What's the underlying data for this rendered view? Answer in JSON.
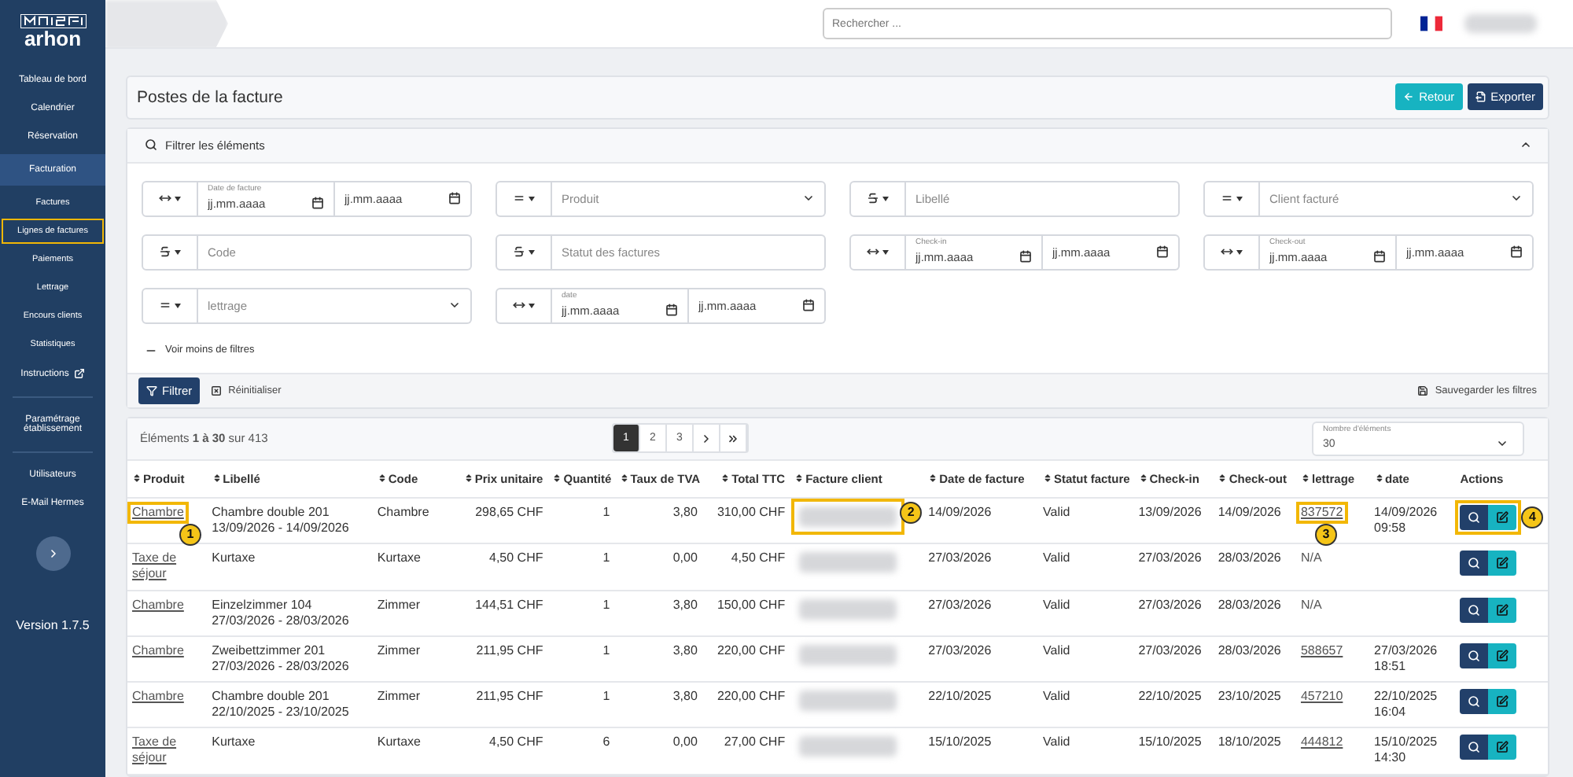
{
  "sidebar": {
    "logo_text": "arhon",
    "items": [
      {
        "label": "Tableau de bord",
        "selected": false,
        "external": false,
        "divider_after": false
      },
      {
        "label": "Calendrier",
        "selected": false,
        "external": false,
        "divider_after": false
      },
      {
        "label": "Réservation",
        "selected": false,
        "external": false,
        "divider_after": false
      },
      {
        "label": "Facturation",
        "selected": true,
        "external": false,
        "divider_after": false,
        "children": [
          {
            "label": "Factures",
            "highlight": false
          },
          {
            "label": "Lignes de factures",
            "highlight": true
          },
          {
            "label": "Paiements",
            "highlight": false
          },
          {
            "label": "Lettrage",
            "highlight": false
          },
          {
            "label": "Encours clients",
            "highlight": false
          },
          {
            "label": "Statistiques",
            "highlight": false
          }
        ]
      },
      {
        "label": "Instructions",
        "selected": false,
        "external": true,
        "divider_after": true
      },
      {
        "label": "Paramétrage établissement",
        "selected": false,
        "external": false,
        "divider_after": true
      },
      {
        "label": "Utilisateurs",
        "selected": false,
        "external": false,
        "divider_after": false
      },
      {
        "label": "E-Mail Hermes",
        "selected": false,
        "external": false,
        "divider_after": false
      }
    ],
    "version": "Version 1.7.5"
  },
  "topbar": {
    "search": {
      "placeholder": "Rechercher ..."
    }
  },
  "page": {
    "title": "Postes de la facture",
    "buttons": [
      {
        "label": "Retour",
        "kind": "back"
      },
      {
        "label": "Exporter",
        "kind": "export"
      }
    ]
  },
  "filters": {
    "title": "Filtrer les éléments",
    "expanded": true,
    "items": [
      {
        "kind": "date_range",
        "label": "Date de facture",
        "from_placeholder": "jj.mm.aaaa",
        "to_placeholder": "jj.mm.aaaa"
      },
      {
        "kind": "select",
        "placeholder": "Produit"
      },
      {
        "kind": "text",
        "placeholder": "Libellé"
      },
      {
        "kind": "select",
        "placeholder": "Client facturé"
      },
      {
        "kind": "text",
        "placeholder": "Code"
      },
      {
        "kind": "text",
        "placeholder": "Statut des factures"
      },
      {
        "kind": "date_range",
        "label": "Check-in",
        "from_placeholder": "jj.mm.aaaa",
        "to_placeholder": "jj.mm.aaaa"
      },
      {
        "kind": "date_range",
        "label": "Check-out",
        "from_placeholder": "jj.mm.aaaa",
        "to_placeholder": "jj.mm.aaaa"
      },
      {
        "kind": "select",
        "placeholder": "lettrage"
      },
      {
        "kind": "date_range",
        "label": "date",
        "from_placeholder": "jj.mm.aaaa",
        "to_placeholder": "jj.mm.aaaa"
      }
    ],
    "toggle_label": "Voir moins de filtres",
    "filter_button": "Filtrer",
    "reset_button": "Réinitialiser",
    "save_button": "Sauvegarder les filtres"
  },
  "table": {
    "summary": "Éléments **1 à 30** sur 413",
    "pages": [
      {
        "label": "1",
        "selected": true
      },
      {
        "label": "2",
        "selected": false
      },
      {
        "label": "3",
        "selected": false
      }
    ],
    "page_size": {
      "label": "Nombre d'éléments",
      "value": "30"
    },
    "columns": [
      {
        "label": "Produit",
        "sortable": true
      },
      {
        "label": "Libellé",
        "sortable": true
      },
      {
        "label": "Code",
        "sortable": true
      },
      {
        "label": "Prix unitaire",
        "sortable": true
      },
      {
        "label": "Quantité",
        "sortable": true
      },
      {
        "label": "Taux de TVA",
        "sortable": true
      },
      {
        "label": "Total TTC",
        "sortable": true
      },
      {
        "label": "Facture client",
        "sortable": true
      },
      {
        "label": "Date de facture",
        "sortable": true
      },
      {
        "label": "Statut facture",
        "sortable": true
      },
      {
        "label": "Check-in",
        "sortable": true
      },
      {
        "label": "Check-out",
        "sortable": true
      },
      {
        "label": "lettrage",
        "sortable": true
      },
      {
        "label": "date",
        "sortable": true
      },
      {
        "label": "Actions",
        "sortable": false
      }
    ],
    "rows": [
      {
        "produit": {
          "text": "Chambre",
          "highlight": true,
          "callout": "1"
        },
        "libelle": [
          "Chambre double 201",
          "13/09/2026 - 14/09/2026"
        ],
        "code": "Chambre",
        "prix": "298,65 CHF",
        "quantite": "1",
        "taux": "3,80",
        "total": "310,00 CHF",
        "facture_client": {
          "highlight": true,
          "callout": "2"
        },
        "date_facture": "14/09/2026",
        "statut": "Valid",
        "check_in": "13/09/2026",
        "check_out": "14/09/2026",
        "lettrage": {
          "text": "837572",
          "link": true,
          "highlight": true,
          "callout": "3"
        },
        "date": "14/09/2026 09:58",
        "actions": {
          "highlight": true,
          "callout": "4"
        }
      },
      {
        "produit": {
          "text": "Taxe de séjour",
          "highlight": false
        },
        "libelle": [
          "Kurtaxe"
        ],
        "code": "Kurtaxe",
        "prix": "4,50 CHF",
        "quantite": "1",
        "taux": "0,00",
        "total": "4,50 CHF",
        "facture_client": {
          "highlight": false
        },
        "date_facture": "27/03/2026",
        "statut": "Valid",
        "check_in": "27/03/2026",
        "check_out": "28/03/2026",
        "lettrage": {
          "text": "N/A",
          "link": false,
          "highlight": false
        },
        "actions": {
          "highlight": false
        }
      },
      {
        "produit": {
          "text": "Chambre",
          "highlight": false
        },
        "libelle": [
          "Einzelzimmer 104",
          "27/03/2026 - 28/03/2026"
        ],
        "code": "Zimmer",
        "prix": "144,51 CHF",
        "quantite": "1",
        "taux": "3,80",
        "total": "150,00 CHF",
        "facture_client": {
          "highlight": false
        },
        "date_facture": "27/03/2026",
        "statut": "Valid",
        "check_in": "27/03/2026",
        "check_out": "28/03/2026",
        "lettrage": {
          "text": "N/A",
          "link": false,
          "highlight": false
        },
        "actions": {
          "highlight": false
        }
      },
      {
        "produit": {
          "text": "Chambre",
          "highlight": false
        },
        "libelle": [
          "Zweibettzimmer 201",
          "27/03/2026 - 28/03/2026"
        ],
        "code": "Zimmer",
        "prix": "211,95 CHF",
        "quantite": "1",
        "taux": "3,80",
        "total": "220,00 CHF",
        "facture_client": {
          "highlight": false
        },
        "date_facture": "27/03/2026",
        "statut": "Valid",
        "check_in": "27/03/2026",
        "check_out": "28/03/2026",
        "lettrage": {
          "text": "588657",
          "link": true,
          "highlight": false
        },
        "date": "27/03/2026 18:51",
        "actions": {
          "highlight": false
        }
      },
      {
        "produit": {
          "text": "Chambre",
          "highlight": false
        },
        "libelle": [
          "Chambre double 201",
          "22/10/2025 - 23/10/2025"
        ],
        "code": "Zimmer",
        "prix": "211,95 CHF",
        "quantite": "1",
        "taux": "3,80",
        "total": "220,00 CHF",
        "facture_client": {
          "highlight": false
        },
        "date_facture": "22/10/2025",
        "statut": "Valid",
        "check_in": "22/10/2025",
        "check_out": "23/10/2025",
        "lettrage": {
          "text": "457210",
          "link": true,
          "highlight": false
        },
        "date": "22/10/2025 16:04",
        "actions": {
          "highlight": false
        }
      },
      {
        "produit": {
          "text": "Taxe de séjour",
          "highlight": false
        },
        "libelle": [
          "Kurtaxe"
        ],
        "code": "Kurtaxe",
        "prix": "4,50 CHF",
        "quantite": "6",
        "taux": "0,00",
        "total": "27,00 CHF",
        "facture_client": {
          "highlight": false
        },
        "date_facture": "15/10/2025",
        "statut": "Valid",
        "check_in": "15/10/2025",
        "check_out": "18/10/2025",
        "lettrage": {
          "text": "444812",
          "link": true,
          "highlight": false
        },
        "date": "15/10/2025 14:30",
        "actions": {
          "highlight": false
        }
      }
    ]
  }
}
